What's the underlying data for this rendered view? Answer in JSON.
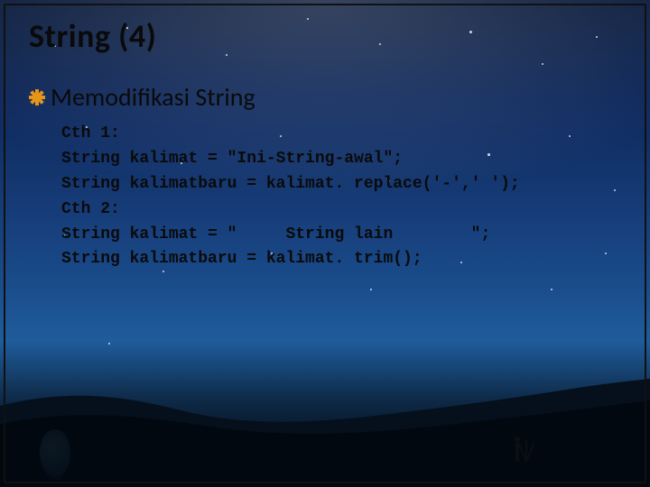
{
  "title": "String (4)",
  "subheading": "Memodifikasi String",
  "code": {
    "l1": "Cth 1:",
    "l2": "String kalimat = \"Ini-String-awal\";",
    "l3": "String kalimatbaru = kalimat. replace('-',' ');",
    "l4": "Cth 2:",
    "l5": "String kalimat = \"     String lain        \";",
    "l6": "String kalimatbaru = kalimat. trim();"
  }
}
